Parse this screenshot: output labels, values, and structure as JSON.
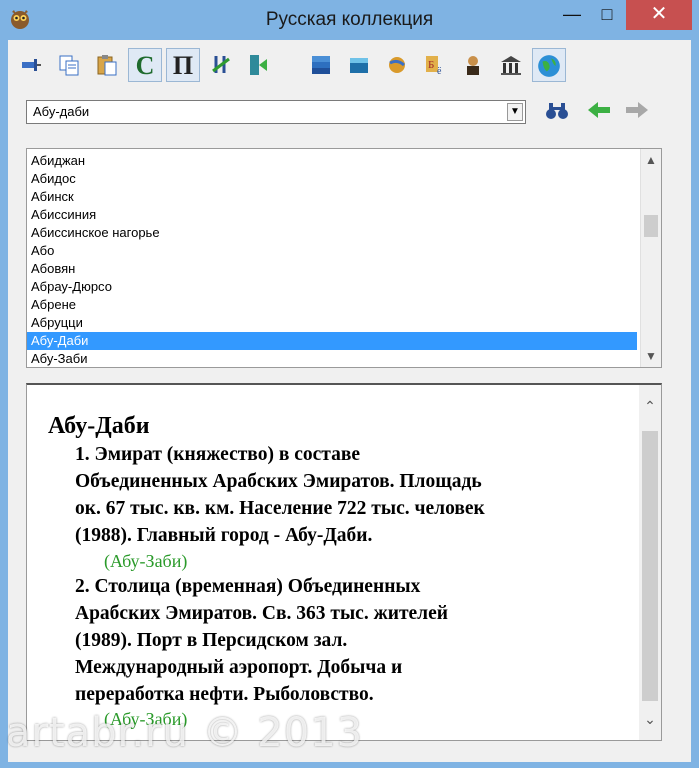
{
  "window": {
    "title": "Русская коллекция"
  },
  "toolbar": {
    "icons": [
      "pin-icon",
      "copy-icon",
      "paste-icon",
      "letter-c-icon",
      "letter-p-icon",
      "sort-icon",
      "exit-icon",
      "book-stack-icon",
      "box-icon",
      "globe-tools-icon",
      "dictionary-icon",
      "person-icon",
      "library-icon",
      "globe-icon"
    ],
    "c_letter": "С",
    "p_letter": "П"
  },
  "search": {
    "value": "Абу-даби"
  },
  "list": {
    "items": [
      "Абиджан",
      "Абидос",
      "Абинск",
      "Абиссиния",
      "Абиссинское нагорье",
      "Або",
      "Абовян",
      "Абрау-Дюрсо",
      "Абрене",
      "Абруцци",
      "Абу-Даби",
      "Абу-Заби"
    ],
    "selected_index": 10
  },
  "article": {
    "title": "Абу-Даби",
    "sections": [
      {
        "lines": [
          "1. Эмират (княжество) в составе",
          "Объединенных Арабских Эмиратов. Площадь",
          "ок. 67 тыс. кв. км. Население 722 тыс. человек",
          "(1988). Главный город - Абу-Даби."
        ],
        "link": "(Абу-Заби)"
      },
      {
        "lines": [
          "2. Столица (временная) Объединенных",
          "Арабских Эмиратов. Св. 363 тыс. жителей",
          "(1989). Порт в Персидском зал.",
          "Международный аэропорт. Добыча и",
          "переработка нефти. Рыболовство."
        ],
        "link": "(Абу-Заби)"
      }
    ]
  },
  "watermark": "artabr.ru © 2013",
  "colors": {
    "titlebar": "#7fb3e3",
    "selection": "#3399ff",
    "link": "#2a9a2a",
    "close": "#c75050"
  }
}
